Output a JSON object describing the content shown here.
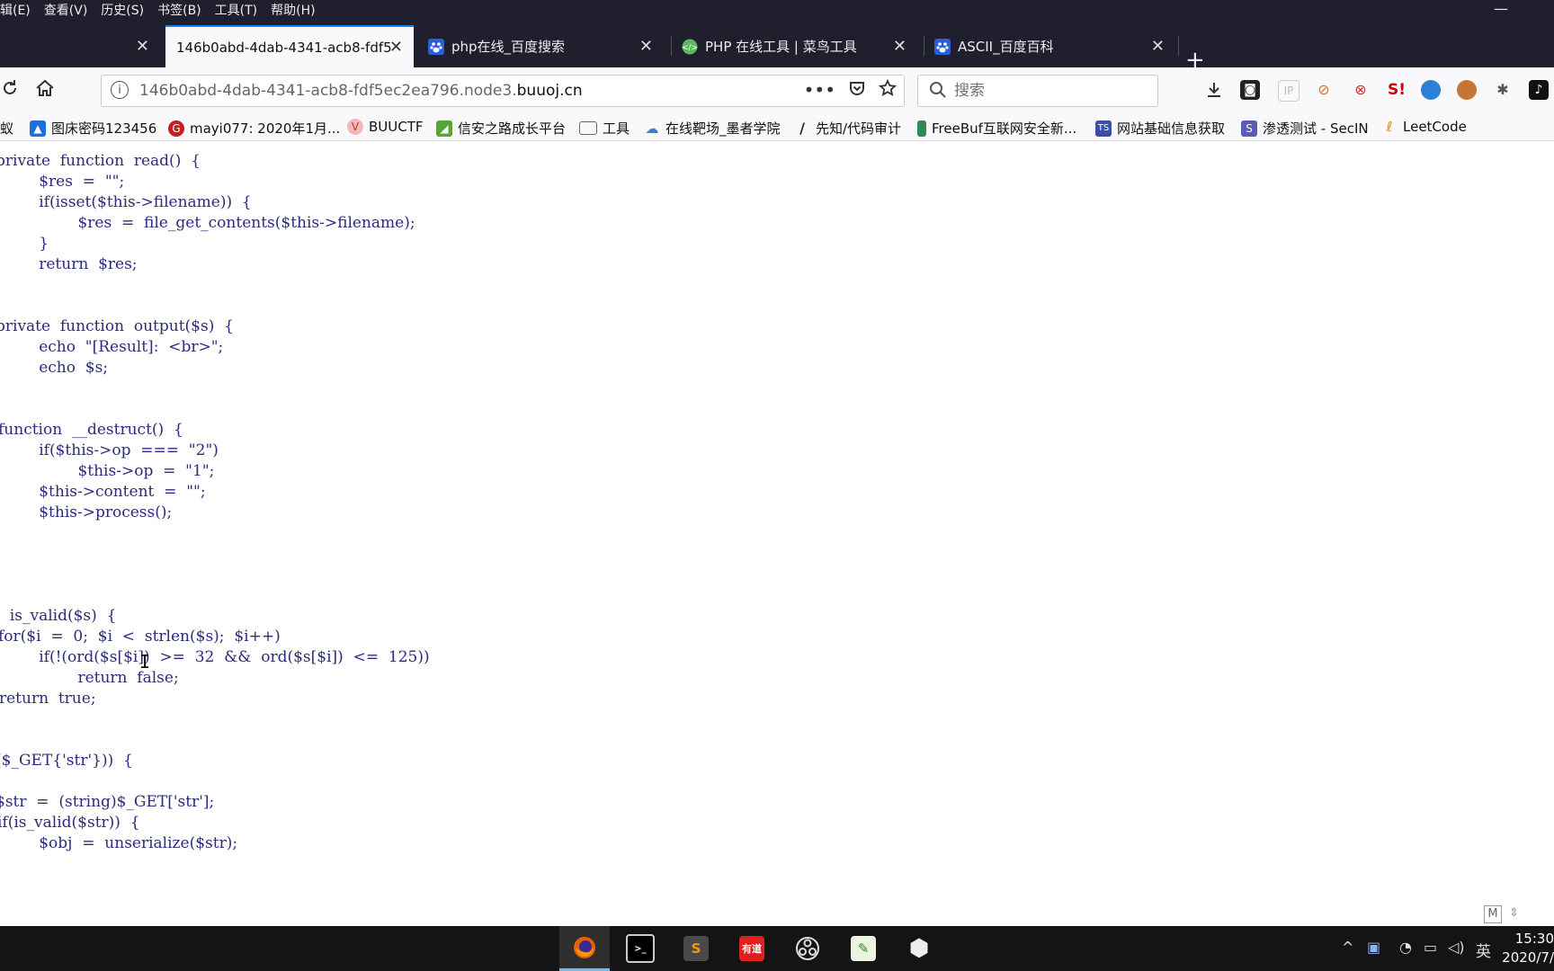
{
  "menubar": {
    "items": [
      "辑(E)",
      "查看(V)",
      "历史(S)",
      "书签(B)",
      "工具(T)",
      "帮助(H)"
    ],
    "minimize": "—"
  },
  "tabs": [
    {
      "title": "",
      "icon": "blank-icon",
      "active": false
    },
    {
      "title": "146b0abd-4dab-4341-acb8-fdf5",
      "icon": "",
      "active": true
    },
    {
      "title": "php在线_百度搜索",
      "icon": "baidu-paw-icon",
      "active": false
    },
    {
      "title": "PHP 在线工具 | 菜鸟工具",
      "icon": "runoob-icon",
      "active": false
    },
    {
      "title": "ASCII_百度百科",
      "icon": "baidu-paw-icon",
      "active": false
    }
  ],
  "new_tab": "+",
  "urlbar": {
    "host_prefix": "146b0abd-4dab-4341-acb8-fdf5ec2ea796.node3.",
    "domain": "buuoj.cn",
    "actions": [
      "•••",
      "pocket-icon",
      "star-icon"
    ]
  },
  "search": {
    "placeholder": "搜索"
  },
  "bookmarks": [
    {
      "label": "蚁",
      "icon": "bookmark-icon",
      "color": "#888888"
    },
    {
      "label": "图床密码123456",
      "icon": "image-icon",
      "color": "#1e6fd9"
    },
    {
      "label": "mayi077: 2020年1月...",
      "icon": "gitee-icon",
      "color": "#c71d23"
    },
    {
      "label": "BUUCTF",
      "icon": "buuctf-icon",
      "color": "#e06666"
    },
    {
      "label": "信安之路成长平台",
      "icon": "leaf-icon",
      "color": "#5aa532"
    },
    {
      "label": "工具",
      "icon": "folder-icon",
      "color": "#666666"
    },
    {
      "label": "在线靶场_墨者学院",
      "icon": "mozhe-icon",
      "color": "#3e7bd6"
    },
    {
      "label": "先知/代码审计",
      "icon": "xianzhi-icon",
      "color": "#222222"
    },
    {
      "label": "FreeBuf互联网安全新...",
      "icon": "freebuf-icon",
      "color": "#2e8b57"
    },
    {
      "label": "网站基础信息获取",
      "icon": "ts-icon",
      "color": "#3b4fa8"
    },
    {
      "label": "渗透测试 - SecIN",
      "icon": "secin-icon",
      "color": "#5b5bb5"
    },
    {
      "label": "LeetCode",
      "icon": "leetcode-icon",
      "color": "#e5a03b"
    }
  ],
  "code": {
    "lines": [
      {
        "t": "private  function  read()  {"
      },
      {
        "t": "        $res  =  \"\";"
      },
      {
        "t": "        if(isset($this->filename))  {"
      },
      {
        "t": "                $res  =  file_get_contents($this->filename);"
      },
      {
        "t": "        }"
      },
      {
        "t": "        return  $res;"
      },
      {
        "t": ""
      },
      {
        "t": ""
      },
      {
        "t": "private  function  output($s)  {"
      },
      {
        "t": "        echo  \"[Result]:  <br>\";"
      },
      {
        "t": "        echo  $s;"
      },
      {
        "t": ""
      },
      {
        "t": ""
      },
      {
        "t": "function  __destruct()  {"
      },
      {
        "t": "        if($this->op  ===  \"2\")"
      },
      {
        "t": "                $this->op  =  \"1\";"
      },
      {
        "t": "        $this->content  =  \"\";"
      },
      {
        "t": "        $this->process();"
      },
      {
        "t": ""
      },
      {
        "t": ""
      },
      {
        "t": ""
      },
      {
        "t": ""
      },
      {
        "t": "  is_valid($s)  {"
      },
      {
        "t": "for($i  =  0;  $i  <  strlen($s);  $i++)"
      },
      {
        "t": "        if(!(ord($s[$i])  >=  32  &&  ord($s[$i])  <=  125))"
      },
      {
        "t": "                return  false;"
      },
      {
        "t": "return  true;"
      },
      {
        "t": ""
      },
      {
        "t": ""
      },
      {
        "t": "($_GET{'str'}))  {"
      },
      {
        "t": ""
      },
      {
        "t": "$str  =  (string)$_GET['str'];"
      },
      {
        "t": "if(is_valid($str))  {"
      },
      {
        "t": "        $obj  =  unserialize($str);"
      }
    ]
  },
  "statusbar": {
    "m_label": "M"
  },
  "taskbar": {
    "apps": [
      {
        "name": "firefox-app",
        "glyph": "🦊",
        "color": "#e66000",
        "active": true
      },
      {
        "name": "terminal-app",
        "glyph": ">_",
        "color": "#333333",
        "active": false
      },
      {
        "name": "sublime-app",
        "glyph": "S",
        "color": "#4a4a4a",
        "active": false
      },
      {
        "name": "youdao-app",
        "glyph": "有道",
        "color": "#e02020",
        "active": false
      },
      {
        "name": "obs-app",
        "glyph": "◎",
        "color": "#202020",
        "active": false
      },
      {
        "name": "notepad-app",
        "glyph": "✎",
        "color": "#6aa84f",
        "active": false
      },
      {
        "name": "cube-app",
        "glyph": "⬢",
        "color": "#eeeeee",
        "active": false
      }
    ],
    "tray": {
      "ime": "英",
      "chevron": "^"
    },
    "clock": {
      "time": "15:30",
      "date": "2020/7/"
    }
  }
}
